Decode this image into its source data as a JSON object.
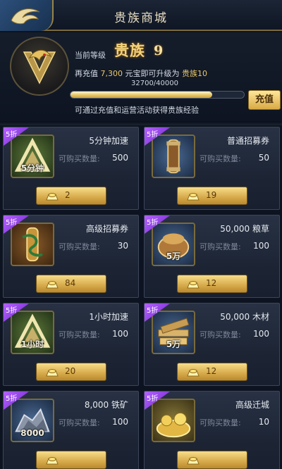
{
  "header": {
    "title": "贵族商城"
  },
  "level": {
    "label": "当前等级",
    "name": "贵族",
    "number": "9",
    "recharge_prefix": "再充值",
    "recharge_amount": "7,300",
    "recharge_mid": "元宝即可升级为",
    "next_level": "贵族10",
    "progress_text": "32700/40000",
    "progress_fraction": 0.8175,
    "hint": "可通过充值和运营活动获得贵族经验",
    "charge_button": "充值"
  },
  "colors": {
    "accent_gold": "#e9c76a",
    "badge_purple": "#8a3ce6",
    "panel": "#1d2535"
  },
  "items": [
    {
      "discount": "5折",
      "icon": "speedup-hourglass-icon",
      "icon_caption": "5分钟",
      "name": "5分钟加速",
      "qty_label": "可购买数量:",
      "qty": "500",
      "price": "2"
    },
    {
      "discount": "5折",
      "icon": "scroll-icon",
      "icon_caption": "",
      "name": "普通招募券",
      "qty_label": "可购买数量:",
      "qty": "50",
      "price": "19"
    },
    {
      "discount": "5折",
      "icon": "dragon-scroll-icon",
      "icon_caption": "",
      "name": "高级招募券",
      "qty_label": "可购买数量:",
      "qty": "30",
      "price": "84"
    },
    {
      "discount": "5折",
      "icon": "grain-sack-icon",
      "icon_caption": "5万",
      "name": "50,000 粮草",
      "qty_label": "可购买数量:",
      "qty": "100",
      "price": "12"
    },
    {
      "discount": "5折",
      "icon": "speedup-hourglass-icon",
      "icon_caption": "1小时",
      "name": "1小时加速",
      "qty_label": "可购买数量:",
      "qty": "100",
      "price": "20"
    },
    {
      "discount": "5折",
      "icon": "lumber-icon",
      "icon_caption": "5万",
      "name": "50,000 木材",
      "qty_label": "可购买数量:",
      "qty": "100",
      "price": "12"
    },
    {
      "discount": "5折",
      "icon": "iron-ore-icon",
      "icon_caption": "8000",
      "name": "8,000 铁矿",
      "qty_label": "可购买数量:",
      "qty": "100",
      "price": ""
    },
    {
      "discount": "5折",
      "icon": "treasure-pile-icon",
      "icon_caption": "",
      "name": "高级迁城",
      "qty_label": "可购买数量:",
      "qty": "10",
      "price": ""
    }
  ]
}
